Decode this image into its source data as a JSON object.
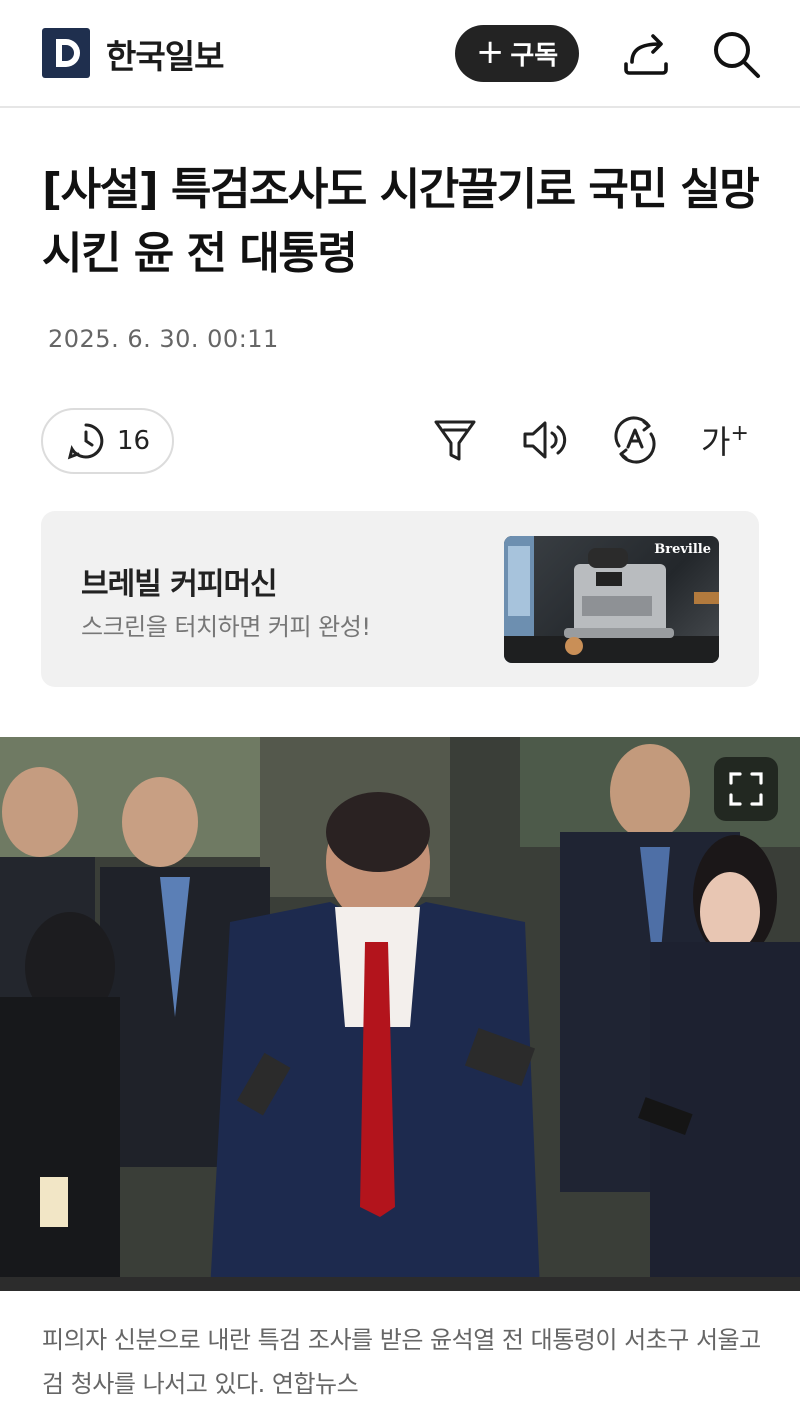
{
  "header": {
    "logo_text": "한국일보",
    "subscribe_label": "구독"
  },
  "article": {
    "title": "[사설] 특검조사도 시간끌기로 국민 실망시킨 윤 전 대통령",
    "date": "2025. 6. 30. 00:11",
    "reading_count": "16",
    "font_size_label": "가"
  },
  "ad": {
    "title": "브레빌 커피머신",
    "description": "스크린을 터치하면 커피 완성!",
    "brand": "Breville"
  },
  "photo": {
    "caption": "피의자 신분으로 내란 특검 조사를 받은 윤석열 전 대통령이 서초구 서울고검 청사를 나서고 있다. 연합뉴스"
  },
  "colors": {
    "brand": "#1f2f4e",
    "button_dark": "#232323",
    "tie_red": "#b3141c"
  },
  "icons": [
    "logo-icon",
    "plus-icon",
    "share-icon",
    "search-icon",
    "clock-icon",
    "filter-icon",
    "speaker-icon",
    "translate-icon",
    "expand-icon"
  ]
}
